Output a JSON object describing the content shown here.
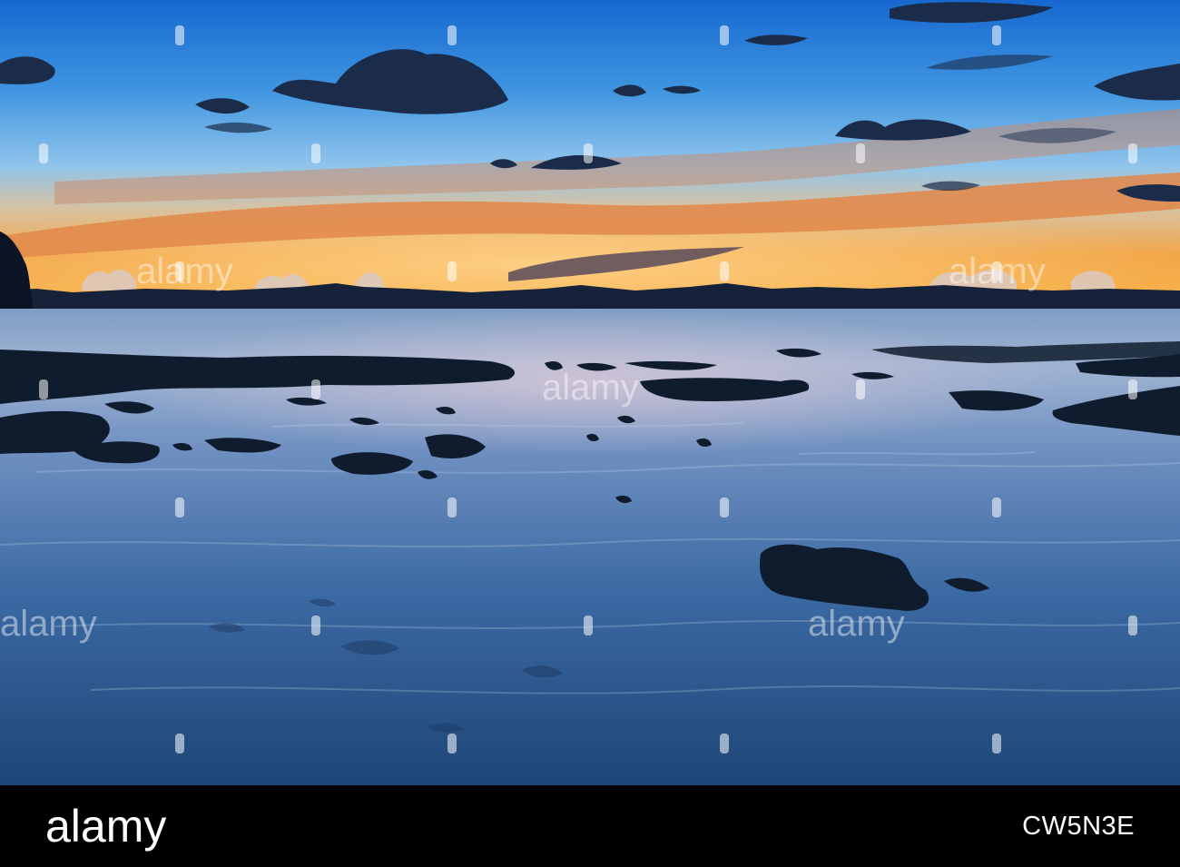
{
  "photo": {
    "description_colors": {
      "sky_top": "#1c6fd4",
      "sky_mid": "#5aa8e6",
      "horizon_glow": "#f3a23a",
      "sea": "#3f6fa6",
      "sea_dark": "#1f4576",
      "rock": "#0d1a2a"
    },
    "watermark_text": "alamy"
  },
  "footer": {
    "brand": "alamy",
    "image_id": "CW5N3E"
  }
}
